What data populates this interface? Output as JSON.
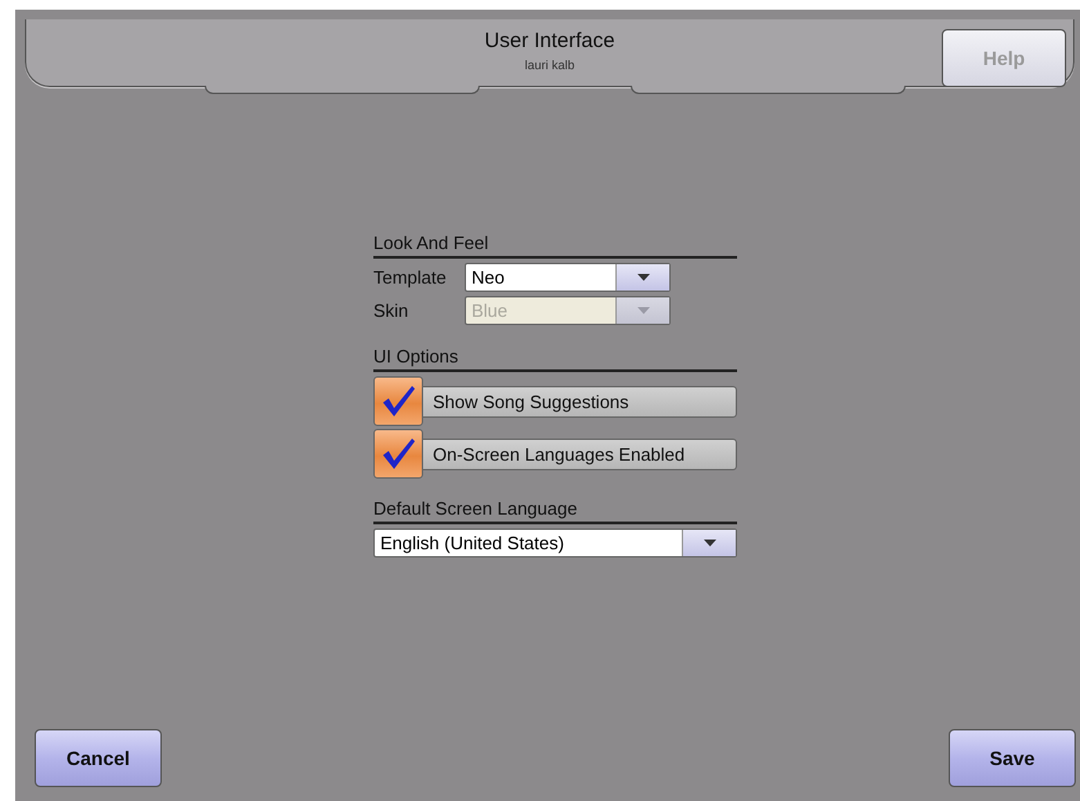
{
  "header": {
    "title": "User Interface",
    "subtitle": "lauri kalb",
    "help_button": {
      "label": "Help",
      "disabled": true
    }
  },
  "sections": [
    {
      "title": "Look And Feel",
      "fields": [
        {
          "kind": "dropdown",
          "label": "Template",
          "value": "Neo",
          "disabled": false
        },
        {
          "kind": "dropdown",
          "label": "Skin",
          "value": "Blue",
          "disabled": true
        }
      ]
    },
    {
      "title": "UI Options",
      "fields": [
        {
          "kind": "checkbox",
          "label": "Show Song Suggestions",
          "checked": true
        },
        {
          "kind": "checkbox",
          "label": "On-Screen Languages Enabled",
          "checked": true
        }
      ]
    },
    {
      "title": "Default Screen Language",
      "fields": [
        {
          "kind": "wide-dropdown",
          "value": "English (United States)",
          "disabled": false
        }
      ]
    }
  ],
  "buttons": [
    {
      "label": "Cancel"
    },
    {
      "label": "Save"
    }
  ]
}
